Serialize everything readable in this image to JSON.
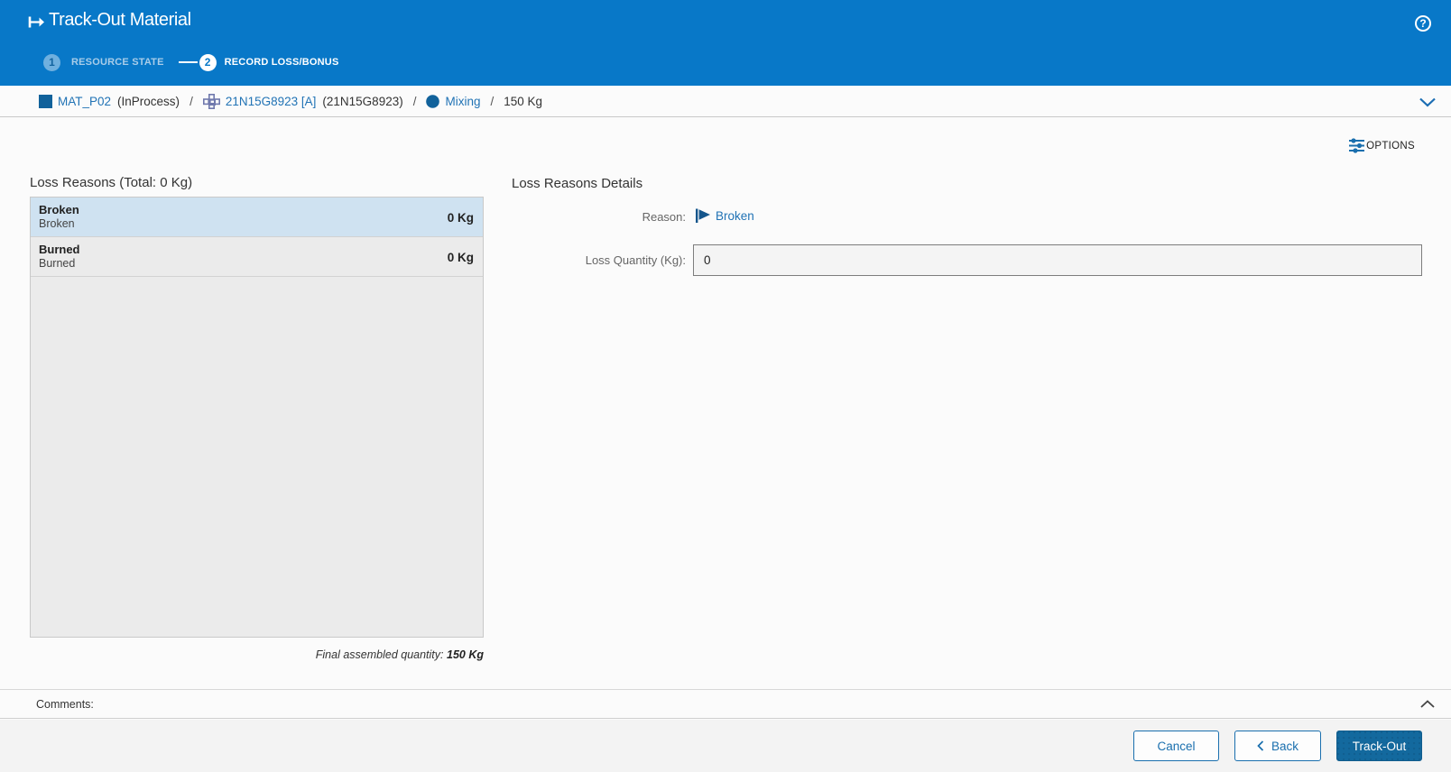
{
  "header": {
    "title": "Track-Out Material",
    "steps": [
      {
        "number": "1",
        "label": "RESOURCE STATE",
        "state": "completed"
      },
      {
        "number": "2",
        "label": "RECORD LOSS/BONUS",
        "state": "active"
      }
    ]
  },
  "breadcrumb": {
    "separator": "/",
    "items": [
      {
        "icon": "material-square",
        "link": "MAT_P02",
        "extra": "(InProcess)"
      },
      {
        "icon": "workflow",
        "link": "21N15G8923 [A]",
        "extra": "(21N15G8923)"
      },
      {
        "icon": "step-circle",
        "link": "Mixing",
        "extra": ""
      },
      {
        "text": "150 Kg"
      }
    ]
  },
  "toolbar": {
    "options_label": "OPTIONS"
  },
  "loss_reasons": {
    "title": "Loss Reasons (Total: 0 Kg)",
    "items": [
      {
        "name": "Broken",
        "description": "Broken",
        "quantity": "0 Kg",
        "selected": true
      },
      {
        "name": "Burned",
        "description": "Burned",
        "quantity": "0 Kg",
        "selected": false
      }
    ],
    "final_label": "Final assembled quantity:",
    "final_value": "150 Kg"
  },
  "details": {
    "title": "Loss Reasons Details",
    "reason_label": "Reason:",
    "reason_value": "Broken",
    "quantity_label": "Loss Quantity (Kg):",
    "quantity_value": "0"
  },
  "comments": {
    "label": "Comments:"
  },
  "footer": {
    "cancel_label": "Cancel",
    "back_label": "Back",
    "trackout_label": "Track-Out"
  },
  "colors": {
    "header_blue": "#0878c8",
    "link_blue": "#2173b5",
    "icon_dark_blue": "#11629b",
    "trackout_button": "#13699e",
    "selected_row": "#cfe2f1"
  }
}
